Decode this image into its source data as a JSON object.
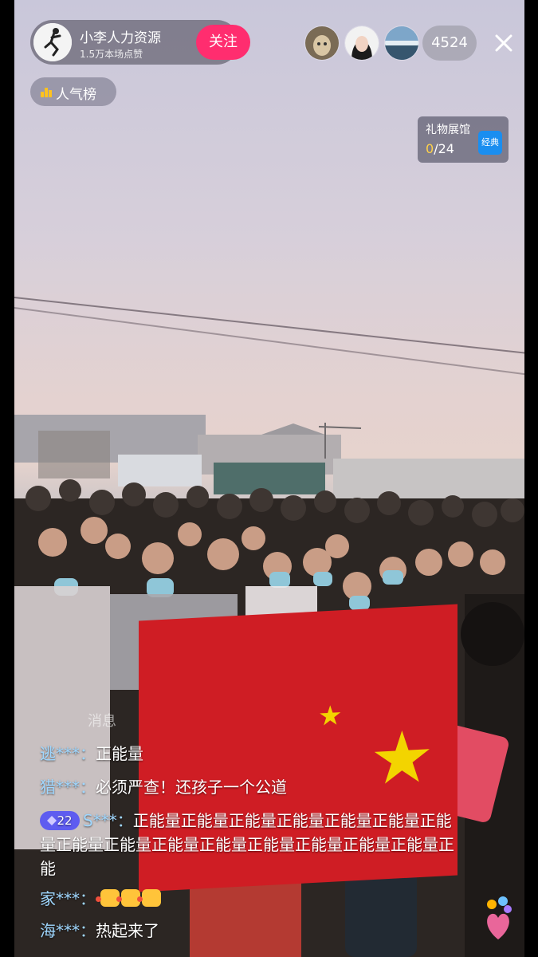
{
  "host": {
    "name": "小李人力资源",
    "likes": "1.5万本场点赞",
    "follow_label": "关注"
  },
  "viewers": {
    "count": "4524",
    "avatars": [
      "viewer-avatar-1",
      "viewer-avatar-2",
      "viewer-avatar-3"
    ]
  },
  "rank": {
    "label": "人气榜",
    "icon": "bar-chart-icon"
  },
  "gift_gallery": {
    "title": "礼物展馆",
    "collected": "0",
    "total": "/24",
    "badge": "经典"
  },
  "chat": {
    "hint": "消息",
    "messages": [
      {
        "user": "逃***：",
        "text": "正能量"
      },
      {
        "user": "猎***：",
        "text": "必须严查！还孩子一个公道"
      },
      {
        "level": "22",
        "user": "S***：",
        "text": "正能量正能量正能量正能量正能量正能量正能量正能量正能量正能量正能量正能量正能量正能量正能量正能"
      },
      {
        "user": "家***：",
        "text": ""
      },
      {
        "user": "海***：",
        "text": "热起来了"
      }
    ]
  },
  "colors": {
    "follow": "#ff2d6f",
    "level_badge": "#5e5cf0",
    "chat_user": "#9fd7ff",
    "flag_red": "#cf1d24",
    "flag_star": "#f3d400"
  }
}
